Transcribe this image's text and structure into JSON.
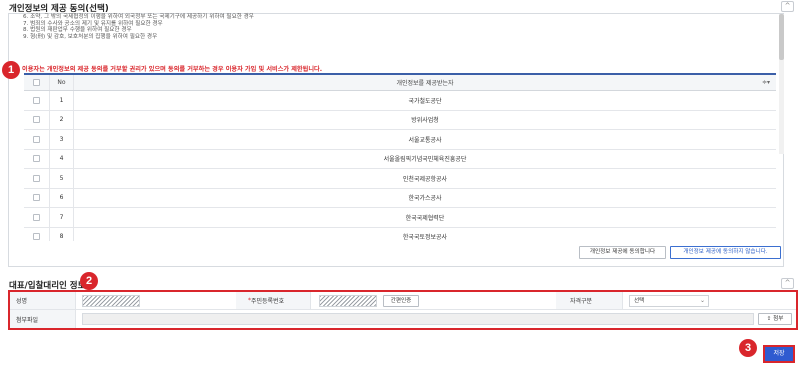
{
  "consent_section": {
    "title": "개인정보의 제공 동의(선택)",
    "notice_lines": [
      "6. 조약, 그 밖의 국제협정의 이행을 위하여 외국정부 또는 국제기구에 제공하기 위하여 필요한 경우",
      "7. 범죄의 수사와 공소의 제기 및 유지를 위하여 필요한 경우",
      "8. 법원의 재판업무 수행을 위하여 필요한 경우",
      "9. 형(刑) 및 감호, 보호처분의 집행을 위하여 필요한 경우"
    ],
    "warning": "이용자는 개인정보의 제공 동의를 거부할 권리가 있으며 동의를 거부하는 경우 이용자 가입 및 서비스가 제한됩니다.",
    "table": {
      "col_no": "No",
      "col_recipient": "개인정보를 제공받는자",
      "rows": [
        {
          "no": "1",
          "org": "국가철도공단"
        },
        {
          "no": "2",
          "org": "방위사업청"
        },
        {
          "no": "3",
          "org": "서울교통공사"
        },
        {
          "no": "4",
          "org": "서울올림픽기념국민체육진흥공단"
        },
        {
          "no": "5",
          "org": "인천국제공항공사"
        },
        {
          "no": "6",
          "org": "한국가스공사"
        },
        {
          "no": "7",
          "org": "한국국제협력단"
        },
        {
          "no": "8",
          "org": "한국국토정보공사"
        }
      ]
    },
    "agree_button": "개인정보 제공에 동의합니다",
    "disagree_button": "개인정보 제공에 동의하지 않습니다."
  },
  "representative_section": {
    "title": "대표/입찰대리인 정보",
    "name_label": "성명",
    "rrn_label": "*주민등록번호",
    "rrn_required_mark": "*",
    "rrn_label_text": "주민등록번호",
    "auth_button": "간편인증",
    "qualification_label": "자격구분",
    "qualification_select": "선택",
    "attachment_label": "첨부파일",
    "attach_button": "첨부"
  },
  "save_button": "저장",
  "badges": [
    "1",
    "2",
    "3"
  ],
  "colors": {
    "accent_blue": "#3b5fa8",
    "save_blue": "#2f5bd0",
    "highlight_red": "#d9262c"
  }
}
